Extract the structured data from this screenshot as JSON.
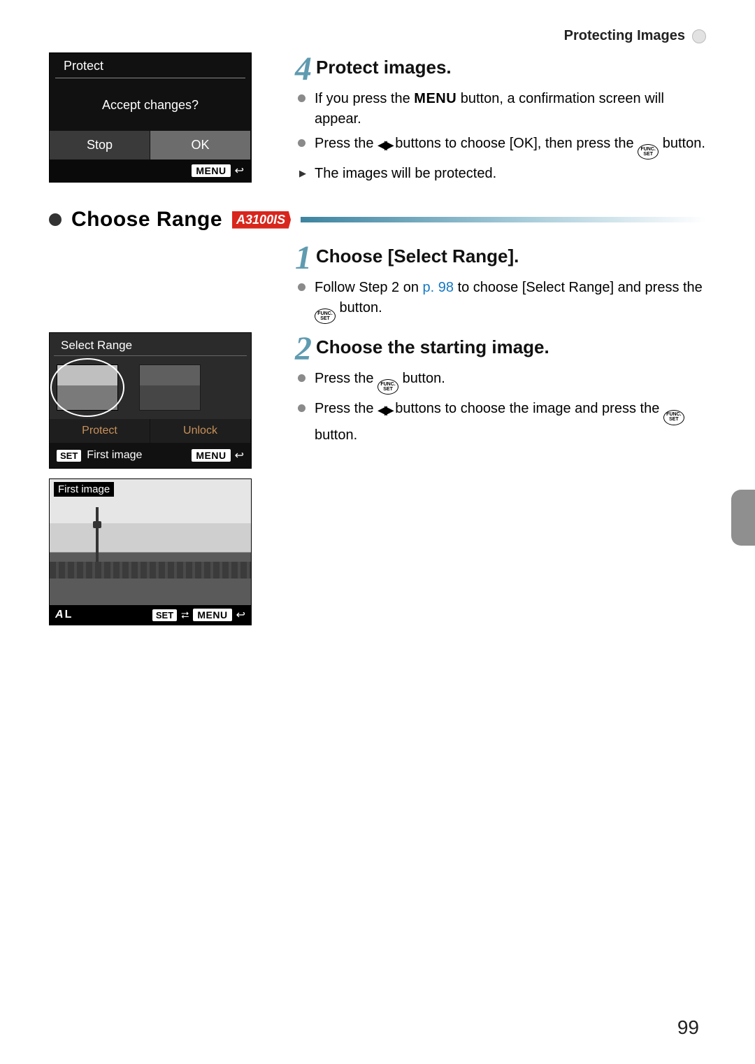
{
  "header": {
    "title": "Protecting Images"
  },
  "lcd1": {
    "title": "Protect",
    "message": "Accept changes?",
    "btn_left": "Stop",
    "btn_right": "OK",
    "menu_label": "MENU"
  },
  "step4": {
    "num": "4",
    "title": "Protect images.",
    "b1a": "If you press the ",
    "b1_menu": "MENU",
    "b1b": " button, a confirmation screen will appear.",
    "b2a": "Press the ",
    "b2b": " buttons to choose [OK], then press the ",
    "b2c": " button.",
    "b3": "The images will be protected."
  },
  "section": {
    "title": "Choose Range",
    "badge": "A3100IS"
  },
  "step1": {
    "num": "1",
    "title": "Choose [Select Range].",
    "b1a": "Follow Step 2 on ",
    "b1_link": "p. 98",
    "b1b": " to choose [Select Range] and press the ",
    "b1c": " button."
  },
  "step2": {
    "num": "2",
    "title": "Choose the starting image.",
    "b1a": "Press the ",
    "b1b": " button.",
    "b2a": "Press the ",
    "b2b": " buttons to choose the image and press the ",
    "b2c": " button."
  },
  "lcd2": {
    "title": "Select Range",
    "btn_left": "Protect",
    "btn_right": "Unlock",
    "set": "SET",
    "foot_text": "First image",
    "menu": "MENU"
  },
  "lcd3": {
    "label": "First image",
    "al_a": "A",
    "al_l": "L",
    "set": "SET",
    "menu": "MENU"
  },
  "funcset": {
    "top": "FUNC.",
    "bot": "SET"
  },
  "page_number": "99"
}
